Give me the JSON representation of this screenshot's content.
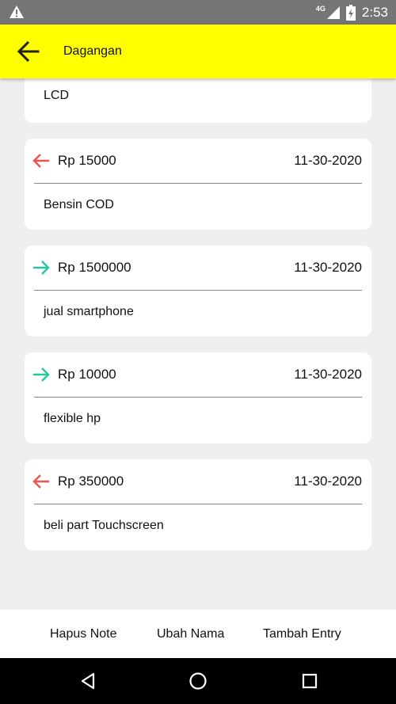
{
  "status_bar": {
    "network": "4G",
    "time": "2:53",
    "icons": [
      "warning-icon",
      "signal-icon",
      "battery-charging-icon"
    ]
  },
  "app_bar": {
    "title": "Dagangan",
    "back_icon": "arrow-left-icon"
  },
  "entries": [
    {
      "note": "LCD"
    },
    {
      "direction": "out",
      "amount": "Rp 15000",
      "date": "11-30-2020",
      "note": "Bensin COD"
    },
    {
      "direction": "in",
      "amount": "Rp 1500000",
      "date": "11-30-2020",
      "note": "jual smartphone"
    },
    {
      "direction": "in",
      "amount": "Rp 10000",
      "date": "11-30-2020",
      "note": "flexible hp"
    },
    {
      "direction": "out",
      "amount": "Rp 350000",
      "date": "11-30-2020",
      "note": "beli part Touchscreen"
    }
  ],
  "colors": {
    "app_bar": "#ffff00",
    "arrow_out": "#ef5350",
    "arrow_in": "#26c6a0",
    "background": "#efefef"
  },
  "actions": {
    "delete": "Hapus Note",
    "rename": "Ubah Nama",
    "add": "Tambah Entry"
  },
  "nav": [
    "back-triangle-icon",
    "home-circle-icon",
    "recents-square-icon"
  ]
}
